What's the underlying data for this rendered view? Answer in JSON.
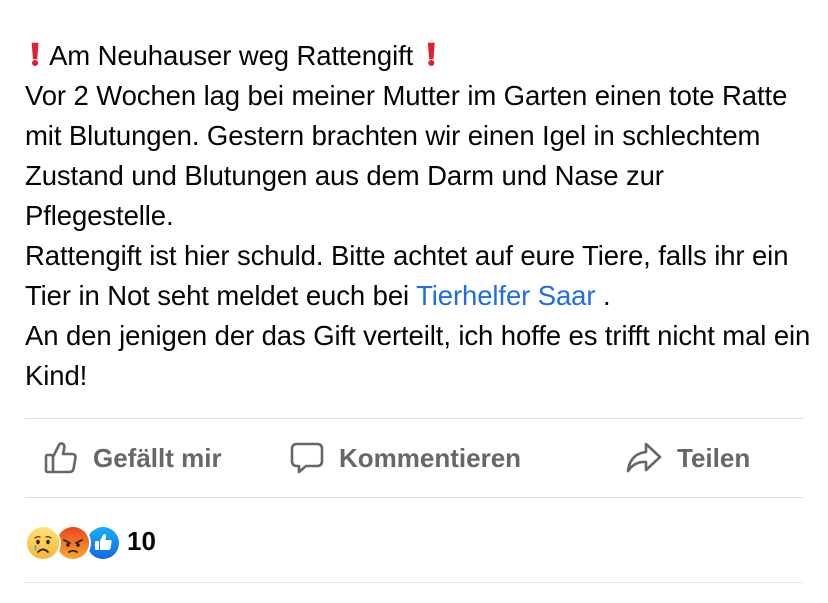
{
  "post": {
    "title_prefix_icon": "red-exclamation-icon",
    "title": "Am Neuhauser weg Rattengift",
    "title_suffix_icon": "red-exclamation-icon",
    "paragraph1": "Vor 2 Wochen lag bei meiner Mutter im Garten einen tote Ratte mit Blutungen. Gestern brachten wir einen Igel in schlechtem Zustand und Blutungen aus dem Darm und Nase zur Pflegestelle.",
    "paragraph2_before_link": "Rattengift ist hier schuld. Bitte achtet auf eure Tiere, falls ihr ein Tier in Not seht meldet euch bei ",
    "paragraph2_link": "Tierhelfer Saar",
    "paragraph2_after_link": " .",
    "paragraph3": "An den jenigen der das Gift verteilt, ich hoffe es trifft nicht mal ein Kind!"
  },
  "actions": {
    "like_label": "Gefällt mir",
    "like_icon": "thumbs-up-icon",
    "comment_label": "Kommentieren",
    "comment_icon": "speech-bubble-icon",
    "share_label": "Teilen",
    "share_icon": "share-arrow-icon"
  },
  "reactions": {
    "emojis": [
      "sad-reaction-icon",
      "angry-reaction-icon",
      "like-reaction-icon"
    ],
    "count": "10"
  },
  "colors": {
    "link": "#216fdb",
    "muted": "#65676b",
    "exclamation": "#e0202d",
    "like_blue": "#1877f2"
  }
}
